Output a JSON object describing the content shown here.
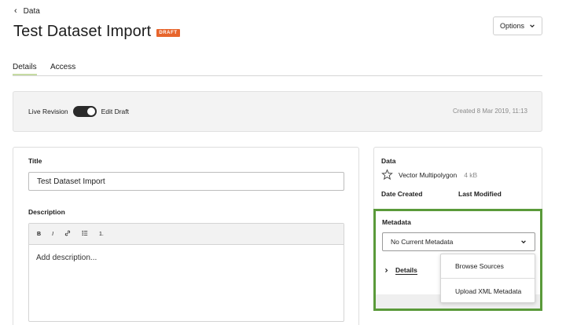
{
  "nav": {
    "back_label": "Data"
  },
  "header": {
    "title": "Test Dataset Import",
    "badge": "DRAFT",
    "options_label": "Options"
  },
  "tabs": [
    {
      "label": "Details",
      "active": true
    },
    {
      "label": "Access",
      "active": false
    }
  ],
  "revision": {
    "live_label": "Live Revision",
    "edit_label": "Edit Draft",
    "toggle_on": true,
    "created": "Created 8 Mar 2019, 11:13"
  },
  "form": {
    "title_label": "Title",
    "title_value": "Test Dataset Import",
    "description_label": "Description",
    "toolbar": [
      "B",
      "I",
      "🔗",
      "≔",
      "1."
    ],
    "description_placeholder": "Add description..."
  },
  "side": {
    "data_label": "Data",
    "data_type": "Vector Multipolygon",
    "data_size": "4 kB",
    "date_created_label": "Date Created",
    "last_modified_label": "Last Modified"
  },
  "metadata": {
    "label": "Metadata",
    "selected": "No Current Metadata",
    "details_label": "Details",
    "menu": [
      "Browse Sources",
      "Upload XML Metadata"
    ]
  },
  "colors": {
    "accent_green": "#5a9a3a",
    "badge_orange": "#e7652c",
    "tab_underline": "#c6dba3"
  },
  "icons": {
    "back": "chevron-left-icon",
    "options": "chevron-down-icon",
    "data": "star-polygon-icon",
    "details": "chevron-right-icon"
  }
}
